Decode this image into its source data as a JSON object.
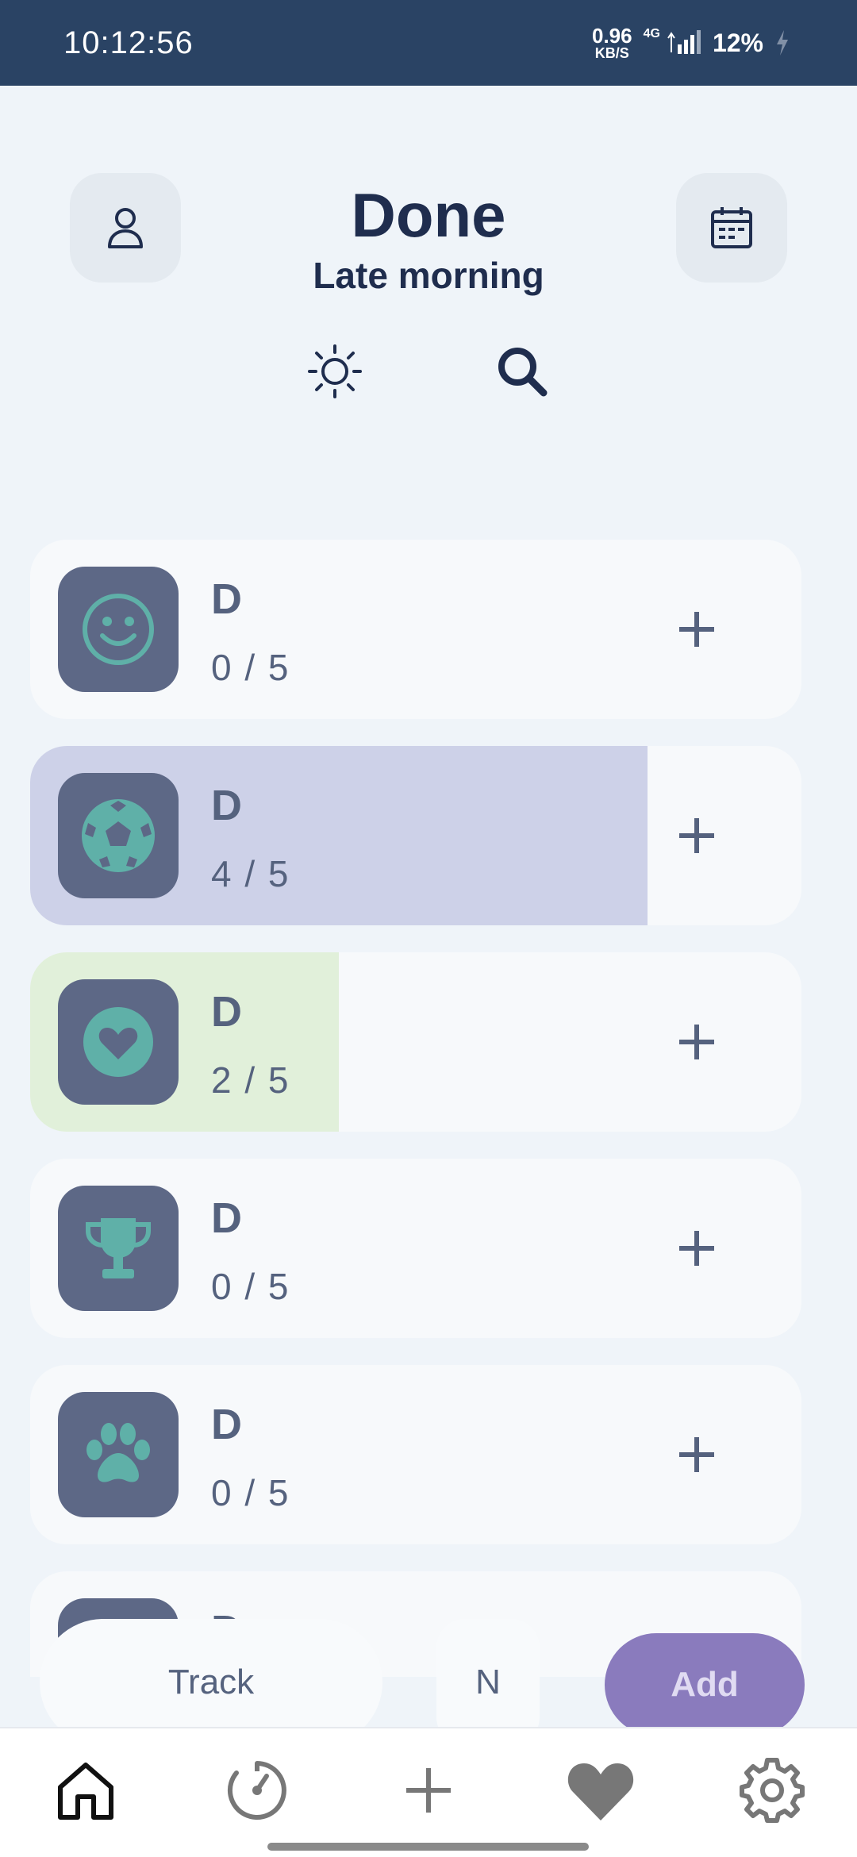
{
  "status_bar": {
    "time": "10:12:56",
    "net_speed_value": "0.96",
    "net_speed_unit": "KB/S",
    "network_type": "4G",
    "battery": "12%"
  },
  "header": {
    "title": "Done",
    "subtitle": "Late morning"
  },
  "habits": [
    {
      "name": "D",
      "count": "0 / 5",
      "icon": "smiley-icon",
      "progress": 0,
      "fill_color": "#f7f9fb"
    },
    {
      "name": "D",
      "count": "4 / 5",
      "icon": "soccer-ball-icon",
      "progress": 0.8,
      "fill_color": "#cdd1e8"
    },
    {
      "name": "D",
      "count": "2 / 5",
      "icon": "heart-icon",
      "progress": 0.4,
      "fill_color": "#e1f0da"
    },
    {
      "name": "D",
      "count": "0 / 5",
      "icon": "trophy-icon",
      "progress": 0,
      "fill_color": "#f7f9fb"
    },
    {
      "name": "D",
      "count": "0 / 5",
      "icon": "paw-icon",
      "progress": 0,
      "fill_color": "#f7f9fb"
    },
    {
      "name": "D",
      "count": "",
      "icon": "music-note-icon",
      "progress": 0,
      "fill_color": "#f7f9fb"
    }
  ],
  "controls": {
    "track_label": "Track",
    "n_label": "N",
    "add_label": "Add"
  },
  "nav": {
    "items": [
      "home-icon",
      "timer-icon",
      "add-icon",
      "heart-icon",
      "gear-icon"
    ]
  },
  "colors": {
    "status_bar": "#2a4364",
    "accent": "#8a7bbd",
    "icon_tile": "#5d6886",
    "icon_glyph": "#5fb0a8"
  }
}
